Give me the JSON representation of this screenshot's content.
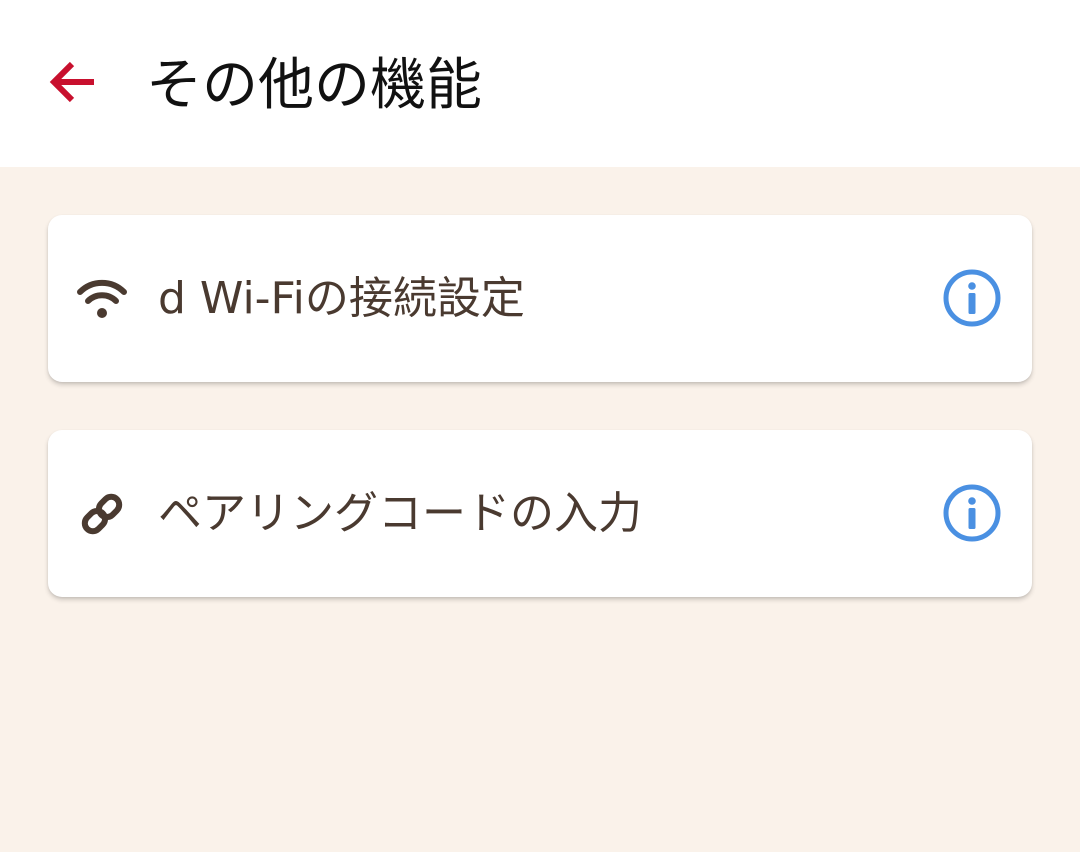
{
  "header": {
    "title": "その他の機能",
    "back_icon": "arrow-left-icon"
  },
  "menu": {
    "items": [
      {
        "label": "d Wi-Fiの接続設定",
        "icon": "wifi-icon",
        "info_icon": "info-icon"
      },
      {
        "label": "ペアリングコードの入力",
        "icon": "link-icon",
        "info_icon": "info-icon"
      }
    ]
  },
  "colors": {
    "accent_back": "#c8102e",
    "background": "#faf2ea",
    "card": "#ffffff",
    "text_primary": "#111111",
    "text_item": "#4a3a30",
    "icon_brown": "#4a3a30",
    "info_blue": "#4a90e2"
  }
}
